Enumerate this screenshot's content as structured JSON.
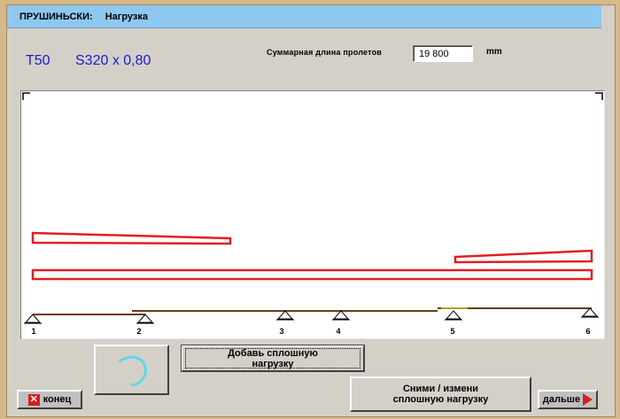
{
  "title": {
    "section": "ПРУШИНЬСКИ:",
    "page": "Нагрузка"
  },
  "profile": {
    "code": "T50",
    "spec": "S320 x 0,80"
  },
  "span": {
    "label": "Суммарная длина пролетов",
    "value": "19 800",
    "unit": "mm"
  },
  "supports": [
    "1",
    "2",
    "3",
    "4",
    "5",
    "6"
  ],
  "buttons": {
    "add_line1": "Добавь сплошную",
    "add_line2": "нагрузку",
    "remove_line1": "Сними  /  измени",
    "remove_line2": "сплошную нагрузку",
    "end": "конец",
    "next": "дальше"
  },
  "icons": {
    "refresh": "refresh-arc-icon",
    "end": "close-x-icon",
    "next": "arrow-right-icon"
  },
  "colors": {
    "title_bg": "#8ec8f0",
    "load_outline": "#e02020",
    "beam": "#6b3a12",
    "accent_blue": "#1a1ad0"
  }
}
